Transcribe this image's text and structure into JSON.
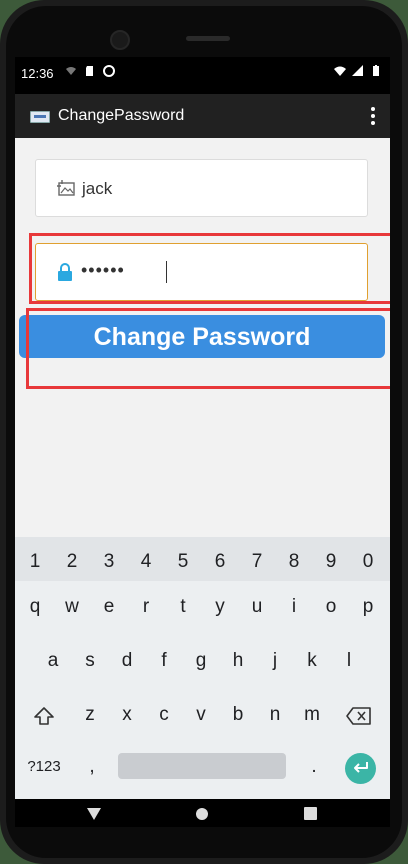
{
  "status_bar": {
    "time": "12:36"
  },
  "app_bar": {
    "title": "ChangePassword"
  },
  "form": {
    "username_value": "jack",
    "password_value": "••••••",
    "change_button_label": "Change Password"
  },
  "keyboard": {
    "number_row": [
      "1",
      "2",
      "3",
      "4",
      "5",
      "6",
      "7",
      "8",
      "9",
      "0"
    ],
    "row1": [
      "q",
      "w",
      "e",
      "r",
      "t",
      "y",
      "u",
      "i",
      "o",
      "p"
    ],
    "row2": [
      "a",
      "s",
      "d",
      "f",
      "g",
      "h",
      "j",
      "k",
      "l"
    ],
    "row3": [
      "z",
      "x",
      "c",
      "v",
      "b",
      "n",
      "m"
    ],
    "symbols_key": "?123",
    "comma_key": ",",
    "period_key": "."
  },
  "colors": {
    "button_bg": "#3a8ee0",
    "highlight": "#e8383a",
    "enter_key": "#3bb5a6",
    "password_border": "#e0a030"
  },
  "icons": {
    "username": "image-icon",
    "password": "lock-icon",
    "menu": "more-vert-icon",
    "backspace": "backspace-icon",
    "shift": "shift-icon",
    "enter": "enter-icon"
  }
}
